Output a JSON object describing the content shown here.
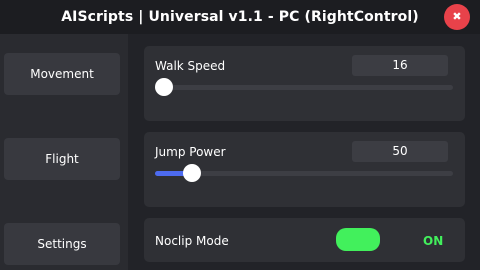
{
  "window": {
    "title": "AIScripts | Universal v1.1 - PC (RightControl)",
    "close_glyph": "✖",
    "close_icon": "close-icon"
  },
  "sidebar": {
    "items": [
      {
        "label": "Movement"
      },
      {
        "label": "Flight"
      },
      {
        "label": "Settings"
      }
    ]
  },
  "settings": {
    "walk_speed": {
      "label": "Walk Speed",
      "value": "16",
      "slider_fraction": 0.0
    },
    "jump_power": {
      "label": "Jump Power",
      "value": "50",
      "slider_fraction": 0.1
    },
    "noclip": {
      "label": "Noclip Mode",
      "state": "ON"
    }
  },
  "colors": {
    "accent": "#4d6bf0",
    "toggle_on": "#42f05c",
    "close": "#e8424a"
  }
}
